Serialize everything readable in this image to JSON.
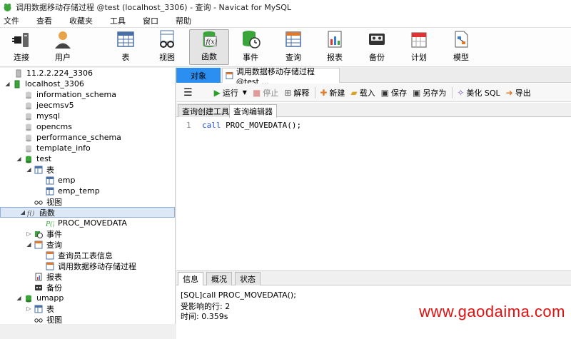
{
  "window": {
    "title": "调用数据移动存储过程 @test (localhost_3306) - 查询 - Navicat for MySQL"
  },
  "menu": [
    "文件",
    "查看",
    "收藏夹",
    "工具",
    "窗口",
    "帮助"
  ],
  "toolbar": {
    "connect": "连接",
    "user": "用户",
    "table": "表",
    "view": "视图",
    "function": "函数",
    "event": "事件",
    "query": "查询",
    "report": "报表",
    "backup": "备份",
    "schedule": "计划",
    "model": "模型"
  },
  "tree": {
    "conn1": "11.2.2.224_3306",
    "conn2": "localhost_3306",
    "dbs": [
      "information_schema",
      "jeecmsv5",
      "mysql",
      "opencms",
      "performance_schema",
      "template_info"
    ],
    "test": "test",
    "tables_label": "表",
    "tables": [
      "emp",
      "emp_temp"
    ],
    "views_label": "视图",
    "functions_label": "函数",
    "proc": "PROC_MOVEDATA",
    "events_label": "事件",
    "queries_label": "查询",
    "queries": [
      "查询员工表信息",
      "调用数据移动存储过程"
    ],
    "reports_label": "报表",
    "backups_label": "备份",
    "umapp": "umapp",
    "umapp_tables": "表",
    "umapp_views": "视图"
  },
  "tabs": {
    "objects": "对象",
    "doc": "调用数据移动存储过程 @test ..."
  },
  "editor_toolbar": {
    "run": "运行",
    "stop": "停止",
    "explain": "解释",
    "new": "新建",
    "load": "载入",
    "save": "保存",
    "save_as": "另存为",
    "beautify": "美化 SQL",
    "export": "导出"
  },
  "subtabs": {
    "builder": "查询创建工具",
    "editor": "查询编辑器"
  },
  "code": {
    "line": "1",
    "keyword": "call",
    "rest": " PROC_MOVEDATA();"
  },
  "bottom_tabs": {
    "info": "信息",
    "profile": "概况",
    "status": "状态"
  },
  "messages": [
    "[SQL]call PROC_MOVEDATA();",
    "受影响的行: 2",
    "时间: 0.359s"
  ],
  "watermark": "www.gaodaima.com",
  "colors": {
    "accent": "#2a8ff0",
    "db_green": "#3aa53a",
    "watermark": "#e01010"
  }
}
